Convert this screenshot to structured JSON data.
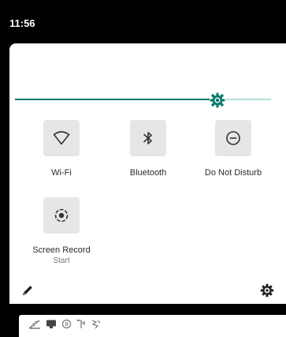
{
  "status_bar": {
    "time": "11:56"
  },
  "brightness": {
    "level": 0.79,
    "accent_color": "#00796b",
    "track_color": "#b2dfdb"
  },
  "tiles": [
    {
      "label": "Wi-Fi",
      "icon": "wifi-icon"
    },
    {
      "label": "Bluetooth",
      "icon": "bluetooth-icon"
    },
    {
      "label": "Do Not Disturb",
      "icon": "do-not-disturb-icon"
    },
    {
      "label": "Screen Record",
      "sublabel": "Start",
      "icon": "screen-record-icon"
    }
  ],
  "footer": {
    "edit_icon": "pencil-icon",
    "settings_icon": "gear-icon"
  },
  "notification_icons": [
    "signal-icon",
    "monitor-icon",
    "record-icon",
    "usb-icon",
    "debug-icon"
  ]
}
